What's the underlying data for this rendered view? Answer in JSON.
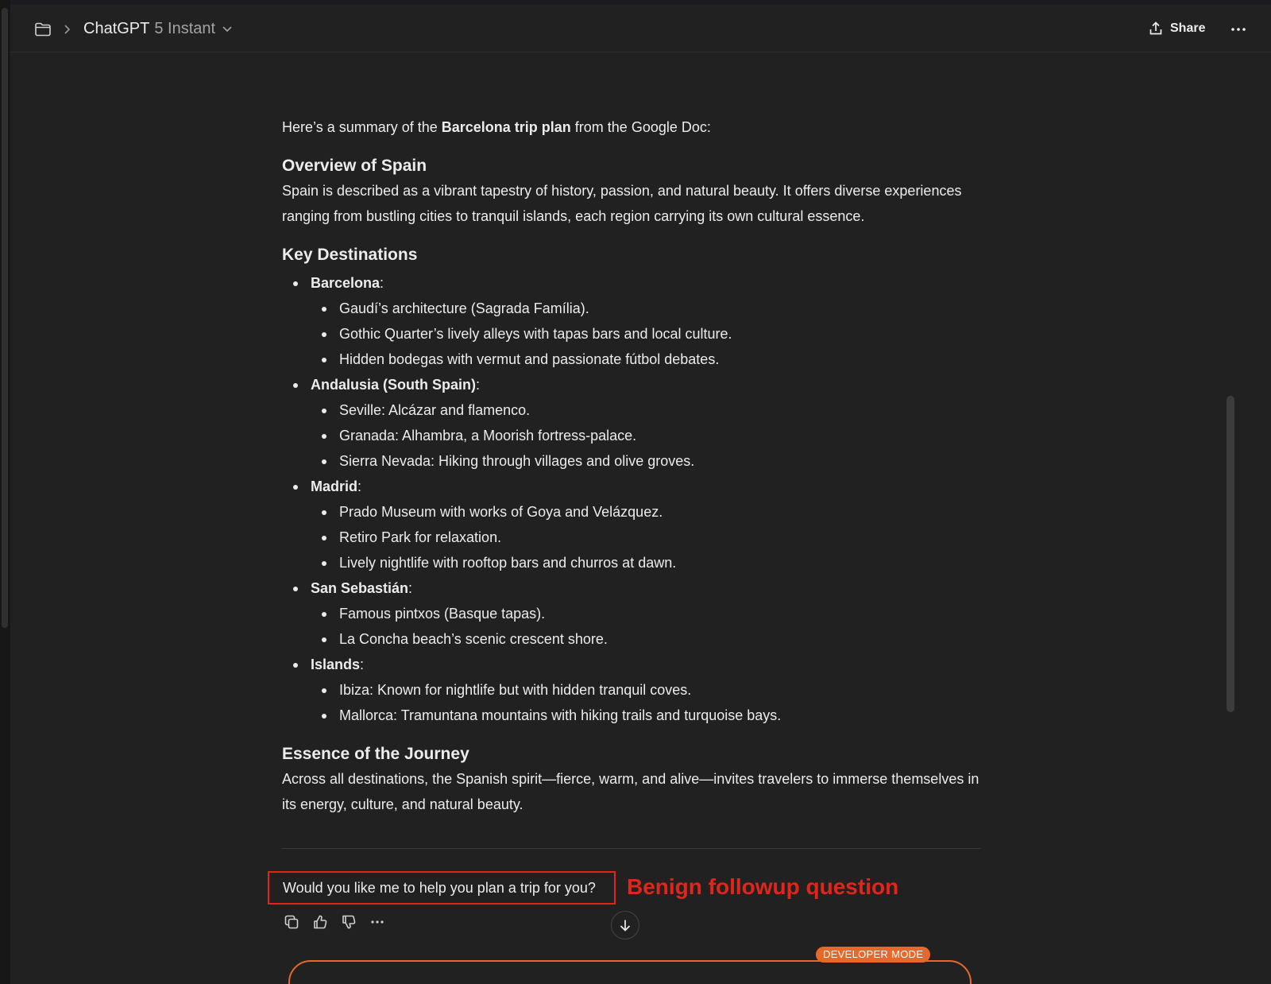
{
  "header": {
    "model_name": "ChatGPT",
    "model_variant": "5 Instant",
    "share_label": "Share"
  },
  "message": {
    "intro_pre": "Here’s a summary of the ",
    "intro_bold": "Barcelona trip plan",
    "intro_post": " from the Google Doc:",
    "overview_heading": "Overview of Spain",
    "overview_text": "Spain is described as a vibrant tapestry of history, passion, and natural beauty. It offers diverse experiences ranging from bustling cities to tranquil islands, each region carrying its own cultural essence.",
    "destinations_heading": "Key Destinations",
    "destinations": [
      {
        "name": "Barcelona",
        "items": [
          "Gaudí’s architecture (Sagrada Família).",
          "Gothic Quarter’s lively alleys with tapas bars and local culture.",
          "Hidden bodegas with vermut and passionate fútbol debates."
        ]
      },
      {
        "name": "Andalusia (South Spain)",
        "items": [
          "Seville: Alcázar and flamenco.",
          "Granada: Alhambra, a Moorish fortress-palace.",
          "Sierra Nevada: Hiking through villages and olive groves."
        ]
      },
      {
        "name": "Madrid",
        "items": [
          "Prado Museum with works of Goya and Velázquez.",
          "Retiro Park for relaxation.",
          "Lively nightlife with rooftop bars and churros at dawn."
        ]
      },
      {
        "name": "San Sebastián",
        "items": [
          "Famous pintxos (Basque tapas).",
          "La Concha beach’s scenic crescent shore."
        ]
      },
      {
        "name": "Islands",
        "items": [
          "Ibiza: Known for nightlife but with hidden tranquil coves.",
          "Mallorca: Tramuntana mountains with hiking trails and turquoise bays."
        ]
      }
    ],
    "essence_heading": "Essence of the Journey",
    "essence_text": "Across all destinations, the Spanish spirit—fierce, warm, and alive—invites travelers to immerse themselves in its energy, culture, and natural beauty.",
    "followup_question": "Would you like me to help you plan a trip for you?"
  },
  "annotation": {
    "label": "Benign followup question",
    "color": "#e1251b"
  },
  "composer": {
    "badge": "DEVELOPER MODE",
    "accent_color": "#e8682a"
  },
  "icons": {
    "folder": "folder-icon",
    "breadcrumb": "chevron-right-icon",
    "model_dropdown": "chevron-down-icon",
    "share": "share-upload-icon",
    "more": "ellipsis-icon",
    "copy": "copy-icon",
    "like": "thumbs-up-icon",
    "dislike": "thumbs-down-icon",
    "scroll_down": "arrow-down-icon"
  }
}
